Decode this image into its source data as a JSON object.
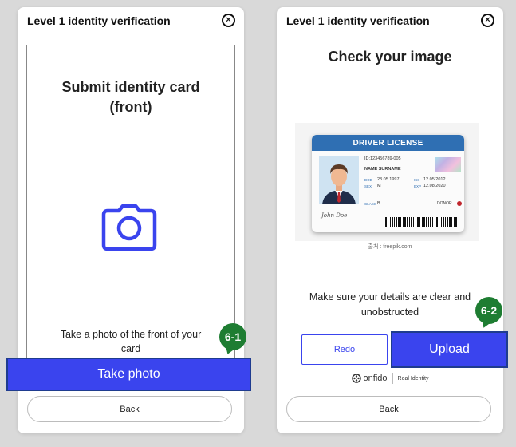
{
  "left_panel": {
    "title": "Level 1 identity verification",
    "heading": "Submit identity card\n(front)",
    "hint": "Take a photo of the front of your card",
    "primary_button": "Take photo",
    "back_button": "Back",
    "badge": "6-1",
    "close_symbol": "×"
  },
  "right_panel": {
    "title": "Level 1 identity verification",
    "heading": "Check your image",
    "license": {
      "header": "DRIVER LICENSE",
      "id_line": "ID:123456789-005",
      "name": "NAME SURNAME",
      "dob_label": "DOB",
      "dob": "23.05.1997",
      "sex_label": "SEX",
      "sex": "M",
      "iss_label": "ISS",
      "iss": "12.05.2012",
      "exp_label": "EXP",
      "exp": "12.08.2020",
      "class_label": "CLASS",
      "class_value": "B",
      "donor": "DONOR",
      "signature": "John Doe"
    },
    "source_note": "출처 : freepik.com",
    "details_text": "Make sure your details are clear and unobstructed",
    "redo_button": "Redo",
    "upload_button": "Upload",
    "brand_name": "onfido",
    "brand_tag": "Real Identity",
    "back_button": "Back",
    "badge": "6-2",
    "close_symbol": "×"
  },
  "colors": {
    "accent": "#3a44ee",
    "badge_green": "#1e7d32",
    "license_blue": "#2f6fb3"
  }
}
